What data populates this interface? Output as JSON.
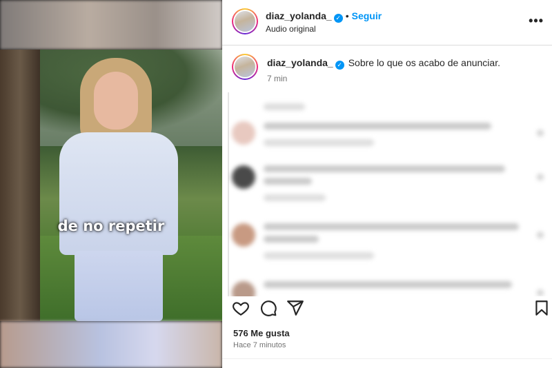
{
  "video": {
    "subtitle": "de no repetir"
  },
  "header": {
    "username": "diaz_yolanda_",
    "separator": "•",
    "follow_label": "Seguir",
    "audio_label": "Audio original",
    "more_icon": "more-horizontal-icon"
  },
  "post_caption": {
    "username": "diaz_yolanda_",
    "text": "Sobre lo que os acabo de anunciar.",
    "time": "7 min"
  },
  "comments": {
    "state": "blurred",
    "items": [
      {
        "avatar_color": "#e8c9c0"
      },
      {
        "avatar_color": "#4a4a4a"
      },
      {
        "avatar_color": "#c89a82"
      },
      {
        "avatar_color": "#b99a8a"
      }
    ]
  },
  "actions": {
    "icons": [
      "heart-icon",
      "comment-icon",
      "share-icon",
      "bookmark-icon"
    ]
  },
  "likes": {
    "text": "576 Me gusta"
  },
  "posted": {
    "text": "Hace 7 minutos"
  },
  "colors": {
    "accent": "#0095f6",
    "text": "#262626",
    "muted": "#737373"
  }
}
